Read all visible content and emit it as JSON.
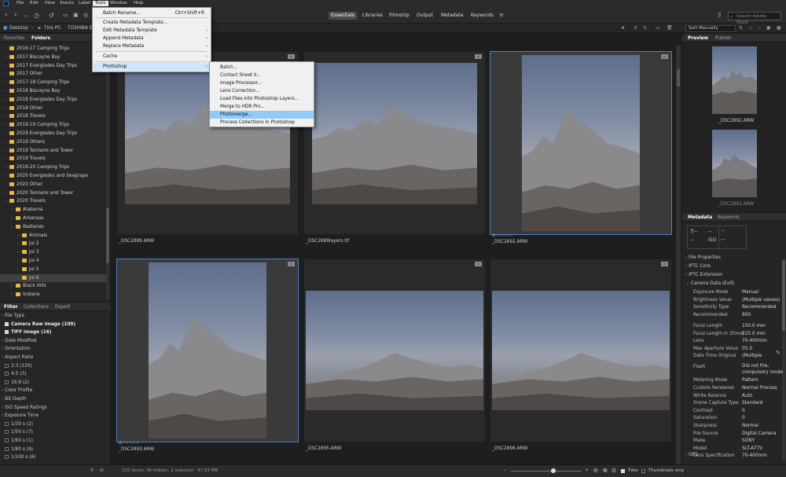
{
  "menubar": {
    "items": [
      "File",
      "Edit",
      "View",
      "Stacks",
      "Label",
      "Tools",
      "Window",
      "Help"
    ],
    "active": "Tools"
  },
  "workspaces": [
    "Essentials",
    "Libraries",
    "Filmstrip",
    "Output",
    "Metadata",
    "Keywords"
  ],
  "search": {
    "placeholder": "Search Adobe Stock"
  },
  "path": {
    "crumbs": [
      "Desktop",
      "This PC",
      "TOSHIBA EX"
    ]
  },
  "sort": {
    "value": "Sort Manually"
  },
  "left_tabs": {
    "favorites": "Favorites",
    "folders": "Folders"
  },
  "folders": [
    {
      "label": "2016-17 Camping Trips",
      "level": 1
    },
    {
      "label": "2017 Biscayne Bay",
      "level": 1
    },
    {
      "label": "2017 Everglades Day Trips",
      "level": 1
    },
    {
      "label": "2017 Other",
      "level": 1
    },
    {
      "label": "2017-18 Camping Trips",
      "level": 1
    },
    {
      "label": "2018 Biscayne Bay",
      "level": 1
    },
    {
      "label": "2018 Everglades Day Trips",
      "level": 1
    },
    {
      "label": "2018 Other",
      "level": 1
    },
    {
      "label": "2018 Travels",
      "level": 1
    },
    {
      "label": "2018-19 Camping Trips",
      "level": 1
    },
    {
      "label": "2019 Everglades Day Trips",
      "level": 1
    },
    {
      "label": "2019 Others",
      "level": 1
    },
    {
      "label": "2019 Tamiami and Tower",
      "level": 1
    },
    {
      "label": "2019 Travels",
      "level": 1
    },
    {
      "label": "2019-20 Camping Trips",
      "level": 1
    },
    {
      "label": "2020 Everglades and Seagrape",
      "level": 1
    },
    {
      "label": "2020 Other",
      "level": 1
    },
    {
      "label": "2020 Tamiami and Tower",
      "level": 1
    },
    {
      "label": "2020 Travels",
      "level": 1
    },
    {
      "label": "Alabama",
      "level": 2
    },
    {
      "label": "Arkansas",
      "level": 2
    },
    {
      "label": "Badlands",
      "level": 2
    },
    {
      "label": "Animals",
      "level": 3
    },
    {
      "label": "Jul 2",
      "level": 3
    },
    {
      "label": "Jul 3",
      "level": 3
    },
    {
      "label": "Jul 4",
      "level": 3
    },
    {
      "label": "Jul 5",
      "level": 3
    },
    {
      "label": "Jul 6",
      "level": 3
    },
    {
      "label": "Black Hills",
      "level": 2
    },
    {
      "label": "Indiana",
      "level": 2
    }
  ],
  "filter_tabs": [
    "Filter",
    "Collections",
    "Export"
  ],
  "filters": [
    {
      "label": "File Type",
      "kind": "header"
    },
    {
      "label": "Camera Raw image (109)",
      "kind": "checked"
    },
    {
      "label": "TIFF image (16)",
      "kind": "checked"
    },
    {
      "label": "Date Modified",
      "kind": "header"
    },
    {
      "label": "Orientation",
      "kind": "header"
    },
    {
      "label": "Aspect Ratio",
      "kind": "header"
    },
    {
      "label": "2:3 (120)",
      "kind": "unchecked"
    },
    {
      "label": "4:5 (3)",
      "kind": "unchecked"
    },
    {
      "label": "16:9 (2)",
      "kind": "unchecked"
    },
    {
      "label": "Color Profile",
      "kind": "header"
    },
    {
      "label": "Bit Depth",
      "kind": "header"
    },
    {
      "label": "ISO Speed Ratings",
      "kind": "header"
    },
    {
      "label": "Exposure Time",
      "kind": "header"
    },
    {
      "label": "1/30 s (2)",
      "kind": "unchecked"
    },
    {
      "label": "1/50 s (7)",
      "kind": "unchecked"
    },
    {
      "label": "1/60 s (1)",
      "kind": "unchecked"
    },
    {
      "label": "1/80 s (9)",
      "kind": "unchecked"
    },
    {
      "label": "1/100 s (6)",
      "kind": "unchecked"
    }
  ],
  "tools_menu": [
    {
      "label": "Batch Rename...",
      "shortcut": "Ctrl+Shift+R",
      "sub": false
    },
    {
      "label": "Create Metadata Template...",
      "shortcut": "",
      "sub": false
    },
    {
      "label": "Edit Metadata Template",
      "shortcut": "",
      "sub": true
    },
    {
      "label": "Append Metadata",
      "shortcut": "",
      "sub": true
    },
    {
      "label": "Replace Metadata",
      "shortcut": "",
      "sub": true
    },
    {
      "label": "Cache",
      "shortcut": "",
      "sub": true
    },
    {
      "label": "Photoshop",
      "shortcut": "",
      "sub": true
    }
  ],
  "photoshop_menu": [
    "Batch...",
    "Contact Sheet II...",
    "Image Processor...",
    "Lens Correction...",
    "Load Files into Photoshop Layers...",
    "Merge to HDR Pro...",
    "Photomerge...",
    "Process Collections in Photoshop"
  ],
  "highlighted_submenu_item": "Photomerge...",
  "thumbnails": [
    {
      "name": "_DSC2889.ARW",
      "selected": false,
      "stars": ""
    },
    {
      "name": "_DSC2889layers.tif",
      "selected": false,
      "stars": ""
    },
    {
      "name": "_DSC2892.ARW",
      "selected": true,
      "stars": "⊘☆☆☆☆☆"
    },
    {
      "name": "_DSC2893.ARW",
      "selected": true,
      "stars": "⊘☆☆☆☆☆"
    },
    {
      "name": "_DSC2895.ARW",
      "selected": false,
      "stars": ""
    },
    {
      "name": "_DSC2896.ARW",
      "selected": false,
      "stars": ""
    }
  ],
  "right_tabs": {
    "preview": "Preview",
    "publish": "Publish"
  },
  "preview_names": [
    "_DSC2892.ARW",
    "_DSC2893.ARW"
  ],
  "meta_tabs": {
    "metadata": "Metadata",
    "keywords": "Keywords"
  },
  "meta_placeholders": {
    "fstop": "f/--",
    "iso": "ISO --",
    "dash": "--"
  },
  "meta_sections": [
    "File Properties",
    "IPTC Core",
    "IPTC Extension",
    "Camera Data (Exif)"
  ],
  "exif": [
    [
      "Exposure Mode",
      "Manual"
    ],
    [
      "Brightness Value",
      "(Multiple values)"
    ],
    [
      "Sensitivity Type",
      "Recommended"
    ],
    [
      "Recommended",
      "800"
    ],
    [
      "",
      ""
    ],
    [
      "Focal Length",
      "150.0 mm"
    ],
    [
      "Focal Length in 35mm",
      "225.0 mm"
    ],
    [
      "Lens",
      "70-400mm"
    ],
    [
      "Max Aperture Value",
      "f/5.0"
    ],
    [
      "Date Time Original",
      "(Multiple"
    ],
    [
      "",
      ""
    ],
    [
      "Flash",
      "Did not fire, compulsory mode"
    ],
    [
      "Metering Mode",
      "Pattern"
    ],
    [
      "Custom Rendered",
      "Normal Process"
    ],
    [
      "White Balance",
      "Auto"
    ],
    [
      "Scene Capture Type",
      "Standard"
    ],
    [
      "Contrast",
      "0"
    ],
    [
      "Saturation",
      "0"
    ],
    [
      "Sharpness",
      "Normal"
    ],
    [
      "File Source",
      "Digital Camera"
    ],
    [
      "Make",
      "SONY"
    ],
    [
      "Model",
      "SLT-A77V"
    ],
    [
      "Lens Specification",
      "70-400mm"
    ]
  ],
  "meta_gps": "GPS",
  "status": {
    "text": "125 items, 36 hidden, 2 selected - 47.63 MB",
    "tiles": "Tiles",
    "thumbnails_only": "Thumbnails only"
  },
  "thumb_slider": {
    "value": 0.6
  }
}
